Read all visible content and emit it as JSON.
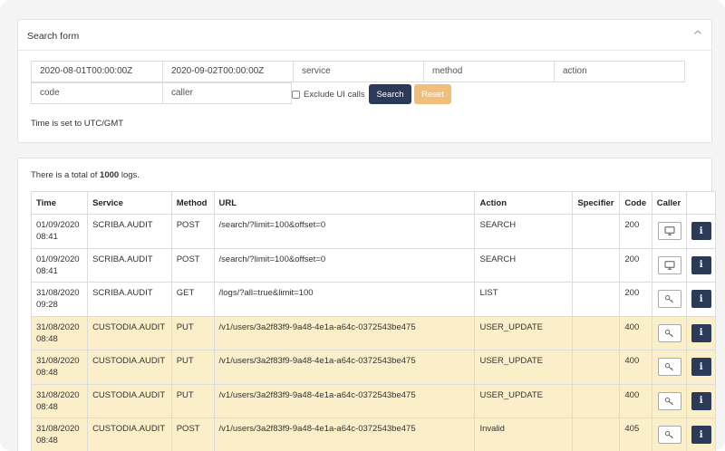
{
  "search_form": {
    "title": "Search form",
    "fields": {
      "date_from": "2020-08-01T00:00:00Z",
      "date_to": "2020-09-02T00:00:00Z",
      "service_placeholder": "service",
      "method_placeholder": "method",
      "action_placeholder": "action",
      "code_placeholder": "code",
      "caller_placeholder": "caller"
    },
    "exclude_ui_label": "Exclude UI calls",
    "search_label": "Search",
    "reset_label": "Reset",
    "timezone_note": "Time is set to UTC/GMT"
  },
  "logs": {
    "total_prefix": "There is a total of ",
    "total_count": "1000",
    "total_suffix": " logs.",
    "columns": [
      "Time",
      "Service",
      "Method",
      "URL",
      "Action",
      "Specifier",
      "Code",
      "Caller"
    ],
    "rows": [
      {
        "date": "01/09/2020",
        "time": "08:41",
        "service": "SCRIBA.AUDIT",
        "method": "POST",
        "url": "/search/?limit=100&offset=0",
        "action": "SEARCH",
        "specifier": "",
        "code": "200",
        "caller_icon": "monitor-icon",
        "highlight": false
      },
      {
        "date": "01/09/2020",
        "time": "08:41",
        "service": "SCRIBA.AUDIT",
        "method": "POST",
        "url": "/search/?limit=100&offset=0",
        "action": "SEARCH",
        "specifier": "",
        "code": "200",
        "caller_icon": "monitor-icon",
        "highlight": false
      },
      {
        "date": "31/08/2020",
        "time": "09:28",
        "service": "SCRIBA.AUDIT",
        "method": "GET",
        "url": "/logs/?all=true&limit=100",
        "action": "LIST",
        "specifier": "",
        "code": "200",
        "caller_icon": "key-icon",
        "highlight": false
      },
      {
        "date": "31/08/2020",
        "time": "08:48",
        "service": "CUSTODIA.AUDIT",
        "method": "PUT",
        "url": "/v1/users/3a2f83f9-9a48-4e1a-a64c-0372543be475",
        "action": "USER_UPDATE",
        "specifier": "",
        "code": "400",
        "caller_icon": "key-icon",
        "highlight": true
      },
      {
        "date": "31/08/2020",
        "time": "08:48",
        "service": "CUSTODIA.AUDIT",
        "method": "PUT",
        "url": "/v1/users/3a2f83f9-9a48-4e1a-a64c-0372543be475",
        "action": "USER_UPDATE",
        "specifier": "",
        "code": "400",
        "caller_icon": "key-icon",
        "highlight": true
      },
      {
        "date": "31/08/2020",
        "time": "08:48",
        "service": "CUSTODIA.AUDIT",
        "method": "PUT",
        "url": "/v1/users/3a2f83f9-9a48-4e1a-a64c-0372543be475",
        "action": "USER_UPDATE",
        "specifier": "",
        "code": "400",
        "caller_icon": "key-icon",
        "highlight": true
      },
      {
        "date": "31/08/2020",
        "time": "08:48",
        "service": "CUSTODIA.AUDIT",
        "method": "POST",
        "url": "/v1/users/3a2f83f9-9a48-4e1a-a64c-0372543be475",
        "action": "Invalid",
        "specifier": "",
        "code": "405",
        "caller_icon": "key-icon",
        "highlight": true
      }
    ],
    "info_glyph": "i"
  },
  "colors": {
    "primary": "#2c3a5a",
    "reset": "#f3bd7a",
    "warning_row": "#fbefc9"
  }
}
